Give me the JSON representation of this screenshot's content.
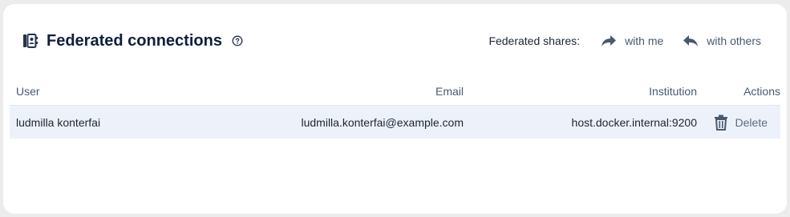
{
  "header": {
    "title": "Federated connections",
    "icon": "address-book-icon",
    "help_icon": "help-circle-icon"
  },
  "shares": {
    "label": "Federated shares:",
    "with_me": "with me",
    "with_me_icon": "share-forward-icon",
    "with_others": "with others",
    "with_others_icon": "reply-back-icon"
  },
  "table": {
    "columns": {
      "user": "User",
      "email": "Email",
      "institution": "Institution",
      "actions": "Actions"
    },
    "rows": [
      {
        "user": "ludmilla konterfai",
        "email": "ludmilla.konterfai@example.com",
        "institution": "host.docker.internal:9200",
        "action_label": "Delete",
        "action_icon": "trash-icon"
      }
    ]
  },
  "colors": {
    "title": "#0f1f3d",
    "muted": "#4a5a6e",
    "row_highlight": "#edf2fa"
  }
}
